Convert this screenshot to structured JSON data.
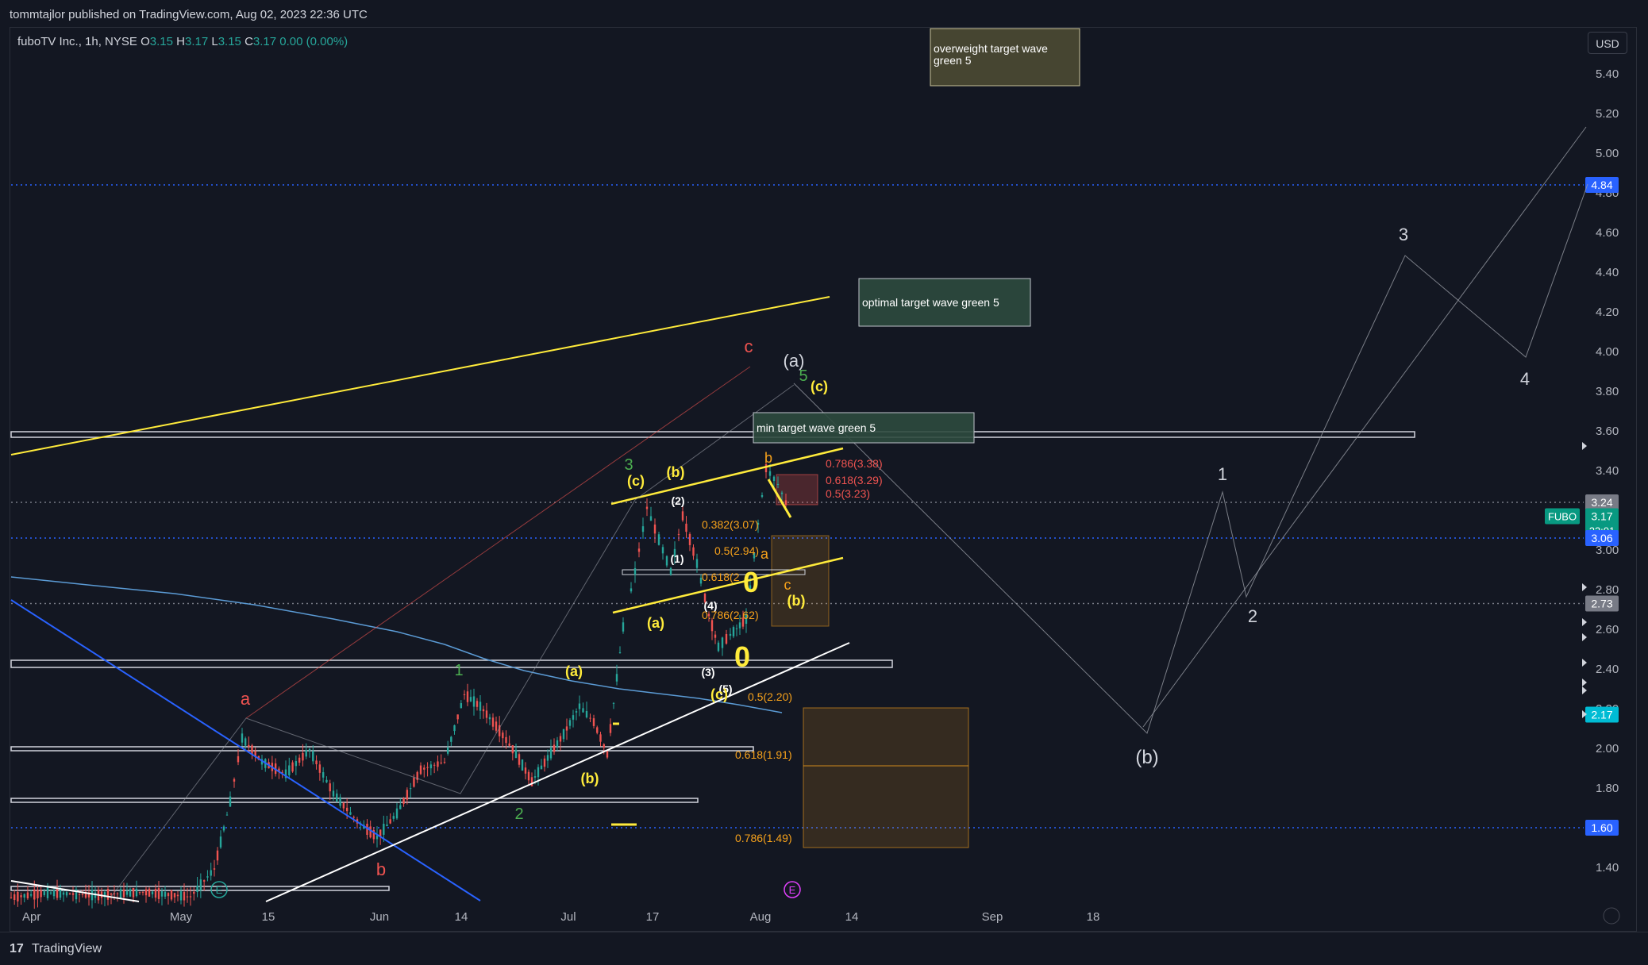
{
  "header": {
    "published": "tommtajlor published on TradingView.com, Aug 02, 2023 22:36 UTC"
  },
  "legend": {
    "symbol": "fuboTV Inc., 1h, NYSE",
    "open_label": "O",
    "open": "3.15",
    "high_label": "H",
    "high": "3.17",
    "low_label": "L",
    "low": "3.15",
    "close_label": "C",
    "close": "3.17",
    "change": "0.00 (0.00%)"
  },
  "currency": "USD",
  "footer": {
    "brand": "TradingView",
    "logo": "17"
  },
  "colors": {
    "background": "#131722",
    "up": "#26a69a",
    "down": "#ef5350",
    "blue_line": "#2962ff",
    "yellow": "#ffeb3b",
    "white": "#ffffff",
    "gray": "#787b86",
    "fib": "#f7a21b",
    "fib_red": "#ef5350",
    "ma": "#5b9bd5"
  },
  "chart_data": {
    "type": "candlestick",
    "symbol": "FUBO",
    "timeframe": "1h",
    "y_axis": {
      "ticks": [
        "1.40",
        "1.60",
        "1.80",
        "2.00",
        "2.20",
        "2.40",
        "2.60",
        "2.80",
        "3.00",
        "3.20",
        "3.40",
        "3.60",
        "3.80",
        "4.00",
        "4.20",
        "4.40",
        "4.60",
        "4.80",
        "5.00",
        "5.20",
        "5.40"
      ],
      "range": [
        1.2,
        5.5
      ]
    },
    "x_axis": {
      "ticks": [
        "Apr",
        "May",
        "15",
        "Jun",
        "14",
        "Jul",
        "17",
        "Aug",
        "14",
        "Sep",
        "18"
      ]
    },
    "price_labels": [
      {
        "value": "4.84",
        "type": "blue"
      },
      {
        "value": "3.24",
        "type": "gray"
      },
      {
        "value": "3.17",
        "type": "current",
        "symbol": "FUBO",
        "countdown": "23:01"
      },
      {
        "value": "3.06",
        "type": "blue"
      },
      {
        "value": "2.73",
        "type": "gray"
      },
      {
        "value": "2.17",
        "type": "cyan"
      },
      {
        "value": "1.60",
        "type": "blue"
      }
    ],
    "horizontal_lines": [
      {
        "price": 4.84,
        "style": "dotted",
        "color": "blue"
      },
      {
        "price": 3.06,
        "style": "dotted",
        "color": "blue"
      },
      {
        "price": 1.6,
        "style": "dotted",
        "color": "blue"
      },
      {
        "price": 3.24,
        "style": "dotted",
        "color": "gray"
      },
      {
        "price": 2.73,
        "style": "dotted",
        "color": "gray"
      }
    ],
    "fib_levels": [
      {
        "label": "0.786(3.38)",
        "price": 3.38
      },
      {
        "label": "0.618(3.29)",
        "price": 3.29
      },
      {
        "label": "0.5(3.23)",
        "price": 3.23
      },
      {
        "label": "0.382(3.07)",
        "price": 3.07
      },
      {
        "label": "0.5(2.94)",
        "price": 2.94
      },
      {
        "label": "0.618(2",
        "price": 2.84
      },
      {
        "label": "0.786(2.62)",
        "price": 2.62
      },
      {
        "label": "0.5(2.20)",
        "price": 2.2
      },
      {
        "label": "0.618(1.91)",
        "price": 1.91
      },
      {
        "label": "0.786(1.49)",
        "price": 1.49
      }
    ],
    "text_boxes": [
      {
        "text": "overweight target wave green 5"
      },
      {
        "text": "optimal target wave green 5"
      },
      {
        "text": "min target wave green 5"
      }
    ],
    "wave_labels": [
      "a",
      "b",
      "c",
      "(a)",
      "5",
      "(c)",
      "3",
      "(b)",
      "1",
      "2",
      "(a)",
      "(b)",
      "(c)",
      "(1)",
      "(2)",
      "(3)",
      "(4)",
      "(5)",
      "(a)",
      "b",
      "a",
      "c",
      "(b)",
      "(c)",
      "1",
      "2",
      "3",
      "4",
      "(b)"
    ],
    "event_markers": [
      "E",
      "E"
    ]
  }
}
